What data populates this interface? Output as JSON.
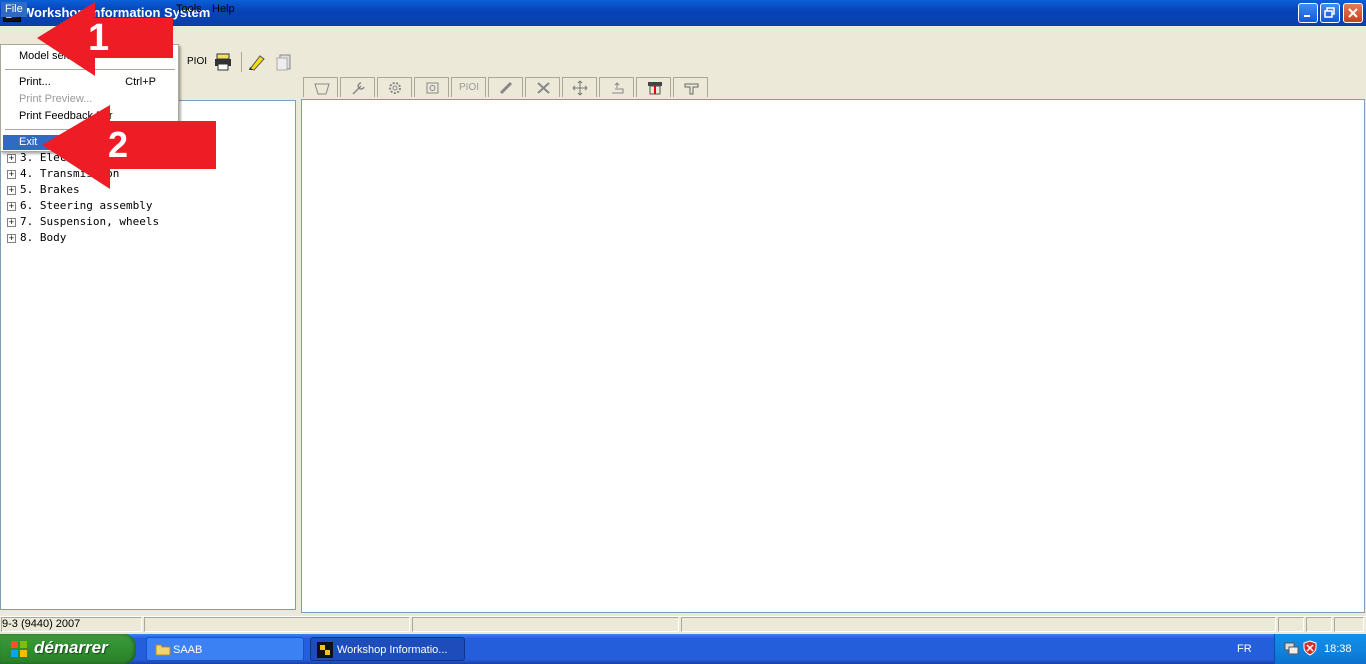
{
  "window": {
    "title": "Workshop Information System",
    "controls": {
      "minimize": "minimize",
      "restore": "restore",
      "close": "close"
    }
  },
  "menubar": {
    "items": [
      {
        "label": "File",
        "active": true
      },
      {
        "label": "Tools"
      },
      {
        "label": "Help"
      }
    ]
  },
  "toolbar": {
    "piol_label": "PIOI"
  },
  "tabs": {
    "piol_label": "PIOI"
  },
  "file_menu": {
    "items": [
      {
        "label": "Model sele",
        "shortcut": "",
        "disabled": false
      },
      {
        "label": "Print...",
        "shortcut": "Ctrl+P",
        "disabled": false
      },
      {
        "label": "Print Preview...",
        "shortcut": "",
        "disabled": true
      },
      {
        "label": "Print Feedback For",
        "shortcut": "",
        "disabled": false
      },
      {
        "label": "Exit",
        "shortcut": "",
        "disabled": false,
        "selected": true
      }
    ]
  },
  "tree": {
    "items": [
      {
        "label": "3. Electrica"
      },
      {
        "label": "4. Transmission"
      },
      {
        "label": "5. Brakes"
      },
      {
        "label": "6. Steering assembly"
      },
      {
        "label": "7. Suspension, wheels"
      },
      {
        "label": "8. Body"
      }
    ]
  },
  "annotations": {
    "step1": "1",
    "step2": "2",
    "color": "#ee1c25"
  },
  "statusbar": {
    "model": "9-3 (9440) 2007"
  },
  "taskbar": {
    "start_label": "démarrer",
    "tasks": [
      {
        "label": "SAAB",
        "icon": "folder-icon"
      },
      {
        "label": "Workshop Informatio...",
        "icon": "app-icon"
      }
    ],
    "language": "FR",
    "clock": "18:38"
  }
}
